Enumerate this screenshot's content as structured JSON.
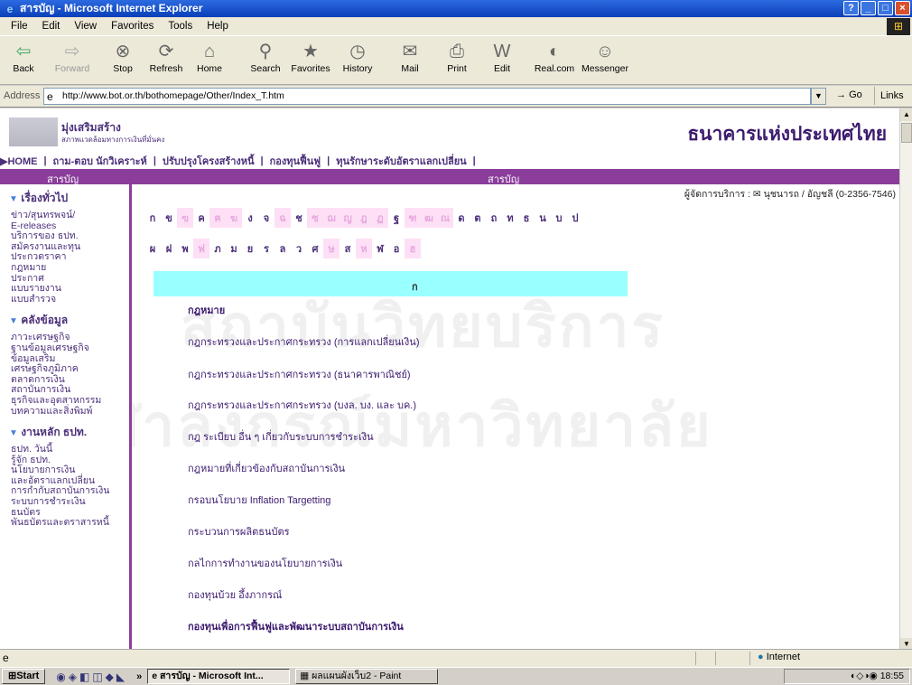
{
  "window": {
    "title": "สารบัญ - Microsoft Internet Explorer"
  },
  "menu": [
    "File",
    "Edit",
    "View",
    "Favorites",
    "Tools",
    "Help"
  ],
  "toolbar": {
    "back": "Back",
    "forward": "Forward",
    "stop": "Stop",
    "refresh": "Refresh",
    "home": "Home",
    "search": "Search",
    "favorites": "Favorites",
    "history": "History",
    "mail": "Mail",
    "print": "Print",
    "edit": "Edit",
    "realcom": "Real.com",
    "messenger": "Messenger"
  },
  "address": {
    "label": "Address",
    "url": "http://www.bot.or.th/bothomepage/Other/Index_T.htm",
    "go": "Go",
    "links": "Links"
  },
  "banner": {
    "slogan1": "มุ่งเสริมสร้าง",
    "slogan2": "สภาพแวดล้อมทางการเงินที่มั่นคง",
    "logo": "ธนาคารแห่งประเทศไทย"
  },
  "topnav": {
    "home": "▶HOME",
    "items": [
      "ถาม-ตอบ นักวิเคราะห์",
      "ปรับปรุงโครงสร้างหนี้",
      "กองทุนฟื้นฟู",
      "ทุนรักษาระดับอัตราแลกเปลี่ยน"
    ]
  },
  "purplebar": {
    "left": "สารบัญ",
    "right": "สารบัญ"
  },
  "sidebar": {
    "sections": [
      {
        "title": "เรื่องทั่วไป",
        "items": [
          "ข่าว/สุนทรพจน์/",
          "E-releases",
          "บริการของ ธปท.",
          "สมัครงานและทุน",
          "ประกวดราคา",
          "กฎหมาย",
          "ประกาศ",
          "แบบรายงาน",
          "แบบสำรวจ"
        ]
      },
      {
        "title": "คลังข้อมูล",
        "items": [
          "ภาวะเศรษฐกิจ",
          "ฐานข้อมูลเศรษฐกิจ",
          "ข้อมูลเสริม",
          "เศรษฐกิจภูมิภาค",
          "ตลาดการเงิน",
          "สถาบันการเงิน",
          "ธุรกิจและอุตสาหกรรม",
          "บทความและสิ่งพิมพ์"
        ]
      },
      {
        "title": "งานหลัก ธปท.",
        "items": [
          "ธปท. วันนี้",
          "รู้จัก ธปท.",
          "นโยบายการเงิน",
          "และอัตราแลกเปลี่ยน",
          "การกำกับสถาบันการเงิน",
          "ระบบการชำระเงิน",
          "ธนบัตร",
          "พันธบัตรและตราสารหนี้"
        ]
      }
    ]
  },
  "main": {
    "coordinator": "ผู้จัดการบริการ : ✉ นุชนารถ / อัญชลี (0-2356-7546)",
    "alphabet_row1": [
      {
        "c": "ก",
        "on": true
      },
      {
        "c": "ข",
        "on": true
      },
      {
        "c": "ฃ",
        "on": false
      },
      {
        "c": "ค",
        "on": true
      },
      {
        "c": "ฅ",
        "on": false
      },
      {
        "c": "ฆ",
        "on": false
      },
      {
        "c": "ง",
        "on": true
      },
      {
        "c": "จ",
        "on": true
      },
      {
        "c": "ฉ",
        "on": false
      },
      {
        "c": "ช",
        "on": true
      },
      {
        "c": "ซ",
        "on": false
      },
      {
        "c": "ฌ",
        "on": false
      },
      {
        "c": "ญ",
        "on": false
      },
      {
        "c": "ฎ",
        "on": false
      },
      {
        "c": "ฏ",
        "on": false
      },
      {
        "c": "ฐ",
        "on": true
      },
      {
        "c": "ฑ",
        "on": false
      },
      {
        "c": "ฒ",
        "on": false
      },
      {
        "c": "ณ",
        "on": false
      },
      {
        "c": "ด",
        "on": true
      },
      {
        "c": "ต",
        "on": true
      },
      {
        "c": "ถ",
        "on": true
      },
      {
        "c": "ท",
        "on": true
      },
      {
        "c": "ธ",
        "on": true
      },
      {
        "c": "น",
        "on": true
      },
      {
        "c": "บ",
        "on": true
      },
      {
        "c": "ป",
        "on": true
      }
    ],
    "alphabet_row2": [
      {
        "c": "ผ",
        "on": true
      },
      {
        "c": "ฝ",
        "on": true
      },
      {
        "c": "พ",
        "on": true
      },
      {
        "c": "ฟ",
        "on": false
      },
      {
        "c": "ภ",
        "on": true
      },
      {
        "c": "ม",
        "on": true
      },
      {
        "c": "ย",
        "on": true
      },
      {
        "c": "ร",
        "on": true
      },
      {
        "c": "ล",
        "on": true
      },
      {
        "c": "ว",
        "on": true
      },
      {
        "c": "ศ",
        "on": true
      },
      {
        "c": "ษ",
        "on": false
      },
      {
        "c": "ส",
        "on": true
      },
      {
        "c": "ห",
        "on": false
      },
      {
        "c": "ฬ",
        "on": true
      },
      {
        "c": "อ",
        "on": true
      },
      {
        "c": "ฮ",
        "on": false
      }
    ],
    "current_letter": "ก",
    "entries": [
      {
        "t": "กฎหมาย",
        "bold": true
      },
      {
        "t": "กฎกระทรวงและประกาศกระทรวง (การแลกเปลี่ยนเงิน)",
        "bold": false
      },
      {
        "t": "กฎกระทรวงและประกาศกระทรวง (ธนาคารพาณิชย์)",
        "bold": false
      },
      {
        "t": "กฎกระทรวงและประกาศกระทรวง (บงล. บง. และ บค.)",
        "bold": false
      },
      {
        "t": "กฎ ระเบียบ อื่น ๆ เกี่ยวกับระบบการชำระเงิน",
        "bold": false
      },
      {
        "t": "กฎหมายที่เกี่ยวข้องกับสถาบันการเงิน",
        "bold": false
      },
      {
        "t": "กรอบนโยบาย Inflation Targetting",
        "bold": false
      },
      {
        "t": "กระบวนการผลิตธนบัตร",
        "bold": false
      },
      {
        "t": "กลไกการทำงานของนโยบายการเงิน",
        "bold": false
      },
      {
        "t": "กองทุนบ้วย อึ้งภากรณ์",
        "bold": false
      },
      {
        "t": "กองทุนเพื่อการฟื้นฟูและพัฒนาระบบสถาบันการเงิน",
        "bold": true
      }
    ]
  },
  "status": {
    "zone": "Internet"
  },
  "taskbar": {
    "start": "Start",
    "task1": "สารบัญ - Microsoft Int...",
    "task2": "ผลแผนผังเว็บ2 - Paint",
    "time": "18:55"
  },
  "watermark": {
    "line1": "สถาบันวิทยบริการ",
    "line2": "จุฬาลงกรณ์มหาวิทยาลัย"
  }
}
